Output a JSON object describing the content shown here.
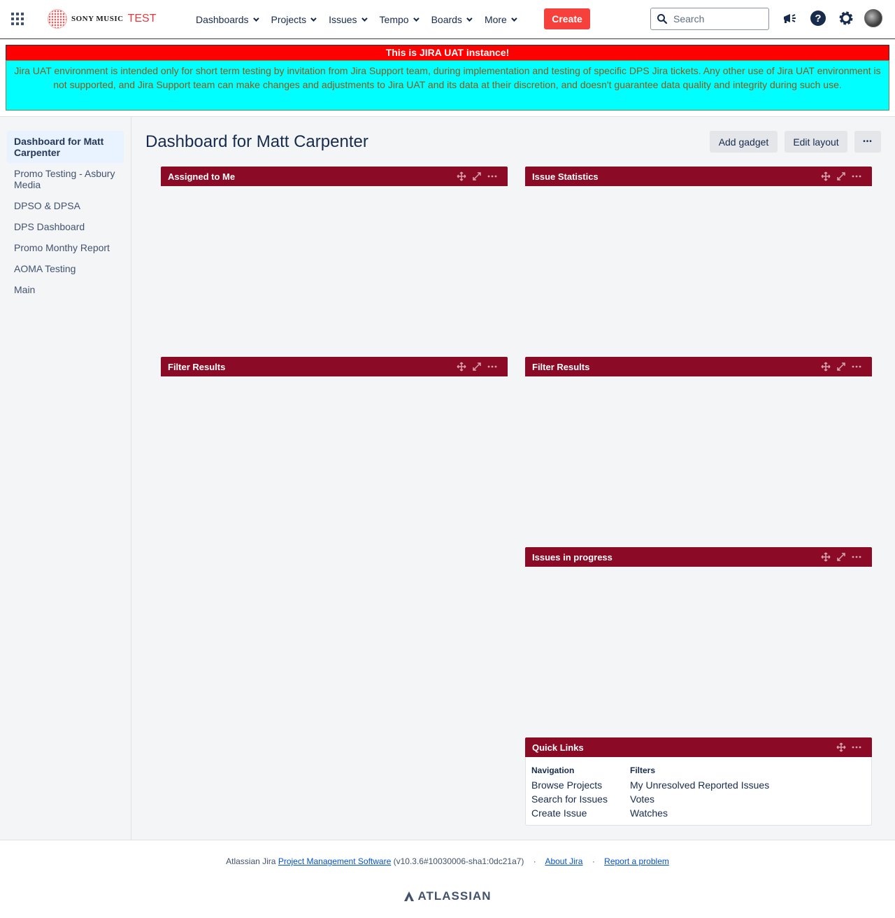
{
  "brand": {
    "name": "SONY MUSIC",
    "env": "TEST"
  },
  "nav": {
    "items": [
      {
        "label": "Dashboards"
      },
      {
        "label": "Projects"
      },
      {
        "label": "Issues"
      },
      {
        "label": "Tempo"
      },
      {
        "label": "Boards"
      },
      {
        "label": "More"
      }
    ],
    "create_label": "Create",
    "search_placeholder": "Search"
  },
  "banners": {
    "title": "This is JIRA UAT instance!",
    "message": "Jira UAT environment is intended only for short term testing by invitation from Jira Support team, during implementation and testing of specific DPS Jira tickets. Any other use of Jira UAT environment is not supported, and Jira Support team can make changes and adjustments to Jira UAT and its data at their discretion, and doesn't guarantee data quality and integrity during such use."
  },
  "sidebar": {
    "items": [
      {
        "label": "Dashboard for Matt Carpenter",
        "active": true
      },
      {
        "label": "Promo Testing - Asbury Media"
      },
      {
        "label": "DPSO & DPSA"
      },
      {
        "label": "DPS Dashboard"
      },
      {
        "label": "Promo Monthy Report"
      },
      {
        "label": "AOMA Testing"
      },
      {
        "label": "Main"
      }
    ]
  },
  "dashboard": {
    "title": "Dashboard for Matt Carpenter",
    "add_gadget": "Add gadget",
    "edit_layout": "Edit layout",
    "more": "•••"
  },
  "gadgets": {
    "assigned": "Assigned to Me",
    "filter1": "Filter Results",
    "issue_stats": "Issue Statistics",
    "filter2": "Filter Results",
    "in_progress": "Issues in progress",
    "quick_links": "Quick Links"
  },
  "quick_links": {
    "navigation": {
      "heading": "Navigation",
      "links": [
        "Browse Projects",
        "Search for Issues",
        "Create Issue"
      ]
    },
    "filters": {
      "heading": "Filters",
      "links": [
        "My Unresolved Reported Issues",
        "Votes",
        "Watches"
      ]
    }
  },
  "footer": {
    "prefix": "Atlassian Jira",
    "pms_link": "Project Management Software",
    "version": "(v10.3.6#10030006-sha1:0dc21a7)",
    "dot": "·",
    "about": "About Jira",
    "report": "Report a problem",
    "brand": "ATLASSIAN"
  },
  "colors": {
    "gadget_header": "#8b0a25",
    "create_button": "#f5403c",
    "banner_red": "#ff0000",
    "banner_cyan": "#00ffff"
  }
}
